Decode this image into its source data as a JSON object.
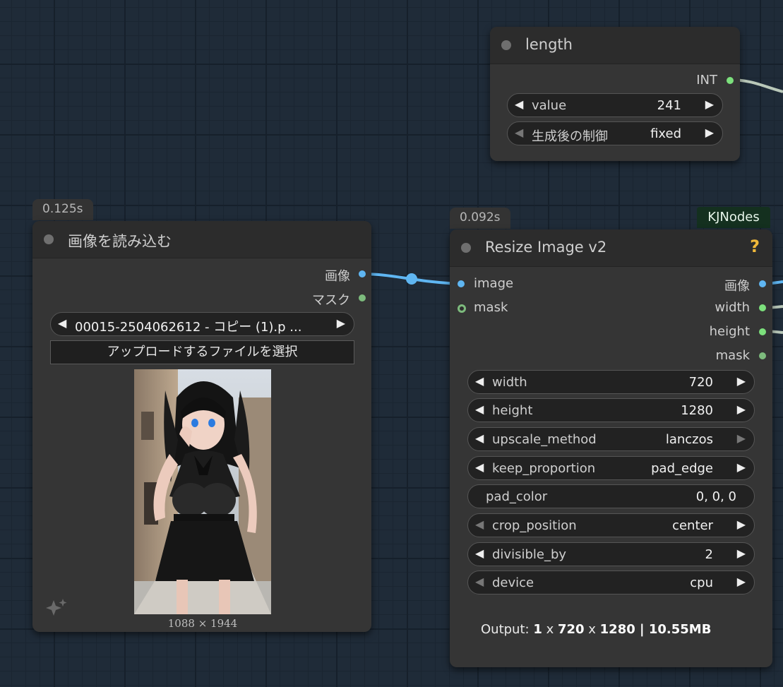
{
  "length_node": {
    "title": "length",
    "output_label": "INT",
    "widgets": [
      {
        "label": "value",
        "value": "241"
      },
      {
        "label": "生成後の制御",
        "value": "fixed"
      }
    ]
  },
  "load_image_node": {
    "timing": "0.125s",
    "title": "画像を読み込む",
    "outputs": [
      "画像",
      "マスク"
    ],
    "file_value": "00015-2504062612 - コピー (1).p ...",
    "upload_label": "アップロードするファイルを選択",
    "preview_size": "1088 × 1944"
  },
  "resize_node": {
    "timing": "0.092s",
    "badge": "KJNodes",
    "title": "Resize Image v2",
    "help": "?",
    "inputs": [
      "image",
      "mask"
    ],
    "outputs": [
      "画像",
      "width",
      "height",
      "mask"
    ],
    "widgets": [
      {
        "label": "width",
        "value": "720"
      },
      {
        "label": "height",
        "value": "1280"
      },
      {
        "label": "upscale_method",
        "value": "lanczos"
      },
      {
        "label": "keep_proportion",
        "value": "pad_edge"
      },
      {
        "label": "pad_color",
        "value": "0, 0, 0"
      },
      {
        "label": "crop_position",
        "value": "center"
      },
      {
        "label": "divisible_by",
        "value": "2"
      },
      {
        "label": "device",
        "value": "cpu"
      }
    ],
    "output_info": {
      "prefix": "Output: ",
      "count": "1",
      "x": " x ",
      "width": "720",
      "height": "1280",
      "size": " | 10.55MB"
    }
  },
  "colors": {
    "canvas": "#1f2b38",
    "node": "#353535",
    "image_link": "#5fb6f2",
    "int_link": "#b9c8b9",
    "badge": "#14301f"
  }
}
